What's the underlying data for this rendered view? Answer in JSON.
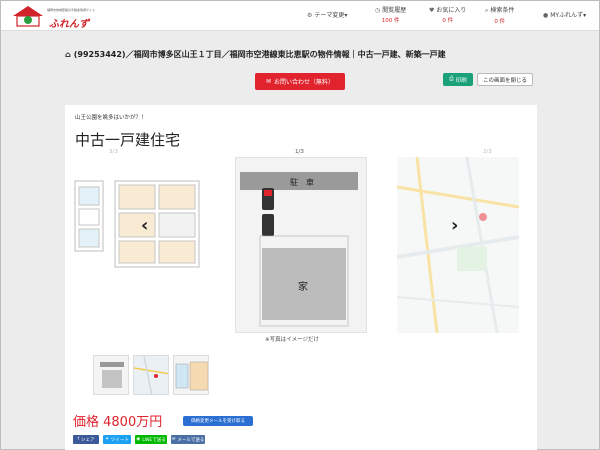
{
  "header": {
    "logo_tag": "福岡市地域密着の不動産情報サイト",
    "logo_text": "ふれんず",
    "nav": [
      {
        "label": "テーマ変更▾",
        "sub": ""
      },
      {
        "label": "閲覧履歴",
        "sub": "100 件"
      },
      {
        "label": "お気に入り",
        "sub": "0 件"
      },
      {
        "label": "検索条件",
        "sub": "0 件"
      },
      {
        "label": "MYふれんず▾",
        "sub": ""
      }
    ]
  },
  "breadcrumb": "(99253442)／福岡市博多区山王１丁目／福岡市空港線東比恵駅の物件情報｜中古一戸建、新築一戸建",
  "buttons": {
    "contact": "お問い合わせ（無料）",
    "print": "印刷",
    "close": "この画面を閉じる"
  },
  "property": {
    "catch": "山王公園を眺多はいかが？！",
    "title": "中古一戸建住宅",
    "counter_left": "3/3",
    "counter_center": "1/3",
    "counter_right": "2/3",
    "photo_note": "※写真はイメージだけ",
    "price": "価格 4800万円",
    "price_notice_button": "価格変更メールを受け取る"
  },
  "share": [
    {
      "label": "シェア",
      "color": "#3b5998"
    },
    {
      "label": "ツイート",
      "color": "#1da1f2"
    },
    {
      "label": "LINEで送る",
      "color": "#00b900"
    },
    {
      "label": "メールで送る",
      "color": "#4a6fa5"
    }
  ],
  "floor_label": "駐　車",
  "lot_label": "家"
}
